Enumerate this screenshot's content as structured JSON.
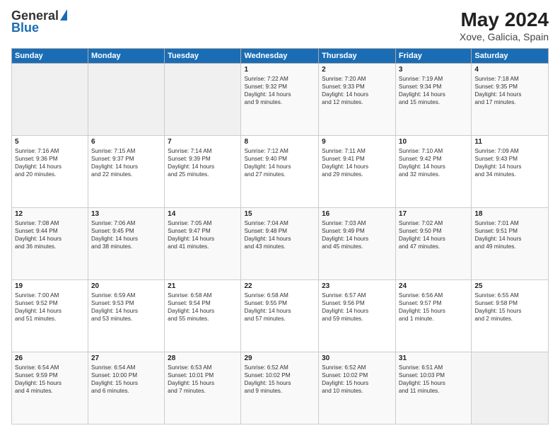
{
  "header": {
    "logo_general": "General",
    "logo_blue": "Blue",
    "month_year": "May 2024",
    "location": "Xove, Galicia, Spain"
  },
  "days_of_week": [
    "Sunday",
    "Monday",
    "Tuesday",
    "Wednesday",
    "Thursday",
    "Friday",
    "Saturday"
  ],
  "weeks": [
    [
      {
        "day": "",
        "text": ""
      },
      {
        "day": "",
        "text": ""
      },
      {
        "day": "",
        "text": ""
      },
      {
        "day": "1",
        "text": "Sunrise: 7:22 AM\nSunset: 9:32 PM\nDaylight: 14 hours\nand 9 minutes."
      },
      {
        "day": "2",
        "text": "Sunrise: 7:20 AM\nSunset: 9:33 PM\nDaylight: 14 hours\nand 12 minutes."
      },
      {
        "day": "3",
        "text": "Sunrise: 7:19 AM\nSunset: 9:34 PM\nDaylight: 14 hours\nand 15 minutes."
      },
      {
        "day": "4",
        "text": "Sunrise: 7:18 AM\nSunset: 9:35 PM\nDaylight: 14 hours\nand 17 minutes."
      }
    ],
    [
      {
        "day": "5",
        "text": "Sunrise: 7:16 AM\nSunset: 9:36 PM\nDaylight: 14 hours\nand 20 minutes."
      },
      {
        "day": "6",
        "text": "Sunrise: 7:15 AM\nSunset: 9:37 PM\nDaylight: 14 hours\nand 22 minutes."
      },
      {
        "day": "7",
        "text": "Sunrise: 7:14 AM\nSunset: 9:39 PM\nDaylight: 14 hours\nand 25 minutes."
      },
      {
        "day": "8",
        "text": "Sunrise: 7:12 AM\nSunset: 9:40 PM\nDaylight: 14 hours\nand 27 minutes."
      },
      {
        "day": "9",
        "text": "Sunrise: 7:11 AM\nSunset: 9:41 PM\nDaylight: 14 hours\nand 29 minutes."
      },
      {
        "day": "10",
        "text": "Sunrise: 7:10 AM\nSunset: 9:42 PM\nDaylight: 14 hours\nand 32 minutes."
      },
      {
        "day": "11",
        "text": "Sunrise: 7:09 AM\nSunset: 9:43 PM\nDaylight: 14 hours\nand 34 minutes."
      }
    ],
    [
      {
        "day": "12",
        "text": "Sunrise: 7:08 AM\nSunset: 9:44 PM\nDaylight: 14 hours\nand 36 minutes."
      },
      {
        "day": "13",
        "text": "Sunrise: 7:06 AM\nSunset: 9:45 PM\nDaylight: 14 hours\nand 38 minutes."
      },
      {
        "day": "14",
        "text": "Sunrise: 7:05 AM\nSunset: 9:47 PM\nDaylight: 14 hours\nand 41 minutes."
      },
      {
        "day": "15",
        "text": "Sunrise: 7:04 AM\nSunset: 9:48 PM\nDaylight: 14 hours\nand 43 minutes."
      },
      {
        "day": "16",
        "text": "Sunrise: 7:03 AM\nSunset: 9:49 PM\nDaylight: 14 hours\nand 45 minutes."
      },
      {
        "day": "17",
        "text": "Sunrise: 7:02 AM\nSunset: 9:50 PM\nDaylight: 14 hours\nand 47 minutes."
      },
      {
        "day": "18",
        "text": "Sunrise: 7:01 AM\nSunset: 9:51 PM\nDaylight: 14 hours\nand 49 minutes."
      }
    ],
    [
      {
        "day": "19",
        "text": "Sunrise: 7:00 AM\nSunset: 9:52 PM\nDaylight: 14 hours\nand 51 minutes."
      },
      {
        "day": "20",
        "text": "Sunrise: 6:59 AM\nSunset: 9:53 PM\nDaylight: 14 hours\nand 53 minutes."
      },
      {
        "day": "21",
        "text": "Sunrise: 6:58 AM\nSunset: 9:54 PM\nDaylight: 14 hours\nand 55 minutes."
      },
      {
        "day": "22",
        "text": "Sunrise: 6:58 AM\nSunset: 9:55 PM\nDaylight: 14 hours\nand 57 minutes."
      },
      {
        "day": "23",
        "text": "Sunrise: 6:57 AM\nSunset: 9:56 PM\nDaylight: 14 hours\nand 59 minutes."
      },
      {
        "day": "24",
        "text": "Sunrise: 6:56 AM\nSunset: 9:57 PM\nDaylight: 15 hours\nand 1 minute."
      },
      {
        "day": "25",
        "text": "Sunrise: 6:55 AM\nSunset: 9:58 PM\nDaylight: 15 hours\nand 2 minutes."
      }
    ],
    [
      {
        "day": "26",
        "text": "Sunrise: 6:54 AM\nSunset: 9:59 PM\nDaylight: 15 hours\nand 4 minutes."
      },
      {
        "day": "27",
        "text": "Sunrise: 6:54 AM\nSunset: 10:00 PM\nDaylight: 15 hours\nand 6 minutes."
      },
      {
        "day": "28",
        "text": "Sunrise: 6:53 AM\nSunset: 10:01 PM\nDaylight: 15 hours\nand 7 minutes."
      },
      {
        "day": "29",
        "text": "Sunrise: 6:52 AM\nSunset: 10:02 PM\nDaylight: 15 hours\nand 9 minutes."
      },
      {
        "day": "30",
        "text": "Sunrise: 6:52 AM\nSunset: 10:02 PM\nDaylight: 15 hours\nand 10 minutes."
      },
      {
        "day": "31",
        "text": "Sunrise: 6:51 AM\nSunset: 10:03 PM\nDaylight: 15 hours\nand 11 minutes."
      },
      {
        "day": "",
        "text": ""
      }
    ]
  ]
}
